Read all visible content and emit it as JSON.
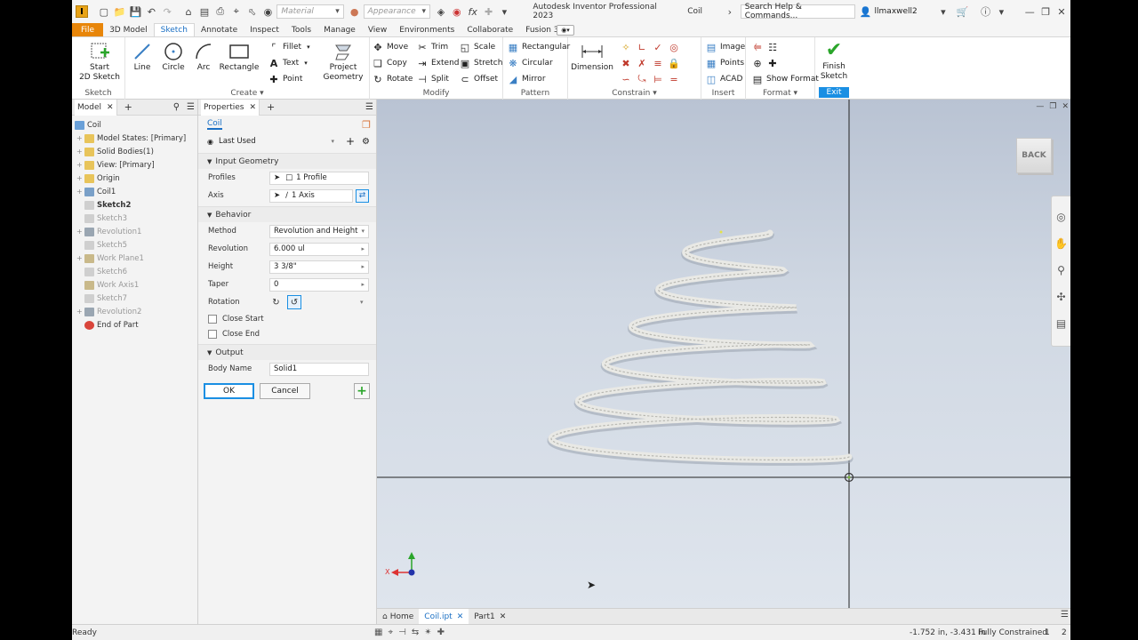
{
  "app": {
    "title": "Autodesk Inventor Professional 2023",
    "doc": "Coil",
    "search_placeholder": "Search Help & Commands...",
    "user": "llmaxwell2",
    "material_placeholder": "Material",
    "appearance_placeholder": "Appearance",
    "logo": "I"
  },
  "menu": {
    "tabs": [
      "File",
      "3D Model",
      "Sketch",
      "Annotate",
      "Inspect",
      "Tools",
      "Manage",
      "View",
      "Environments",
      "Collaborate",
      "Fusion 360"
    ],
    "active": "Sketch"
  },
  "ribbon": {
    "sketch": {
      "start": "Start",
      "start2": "2D Sketch",
      "label": "Sketch"
    },
    "create": {
      "line": "Line",
      "circle": "Circle",
      "arc": "Arc",
      "rectangle": "Rectangle",
      "fillet": "Fillet",
      "text": "Text",
      "point": "Point",
      "project": "Project",
      "project2": "Geometry",
      "label": "Create"
    },
    "modify": {
      "move": "Move",
      "trim": "Trim",
      "scale": "Scale",
      "copy": "Copy",
      "extend": "Extend",
      "stretch": "Stretch",
      "rotate": "Rotate",
      "split": "Split",
      "offset": "Offset",
      "label": "Modify"
    },
    "pattern": {
      "rectangular": "Rectangular",
      "circular": "Circular",
      "mirror": "Mirror",
      "label": "Pattern"
    },
    "constrain": {
      "dimension": "Dimension",
      "label": "Constrain"
    },
    "insert": {
      "image": "Image",
      "points": "Points",
      "acad": "ACAD",
      "label": "Insert"
    },
    "format": {
      "show_format": "Show Format",
      "label": "Format"
    },
    "exit": {
      "finish": "Finish",
      "finish2": "Sketch",
      "label": "Exit"
    }
  },
  "model": {
    "tab": "Model",
    "root": "Coil",
    "items": [
      {
        "label": "Model States: [Primary]",
        "dim": false,
        "bold": false,
        "expand": true,
        "color": "#e8c45a"
      },
      {
        "label": "Solid Bodies(1)",
        "dim": false,
        "bold": false,
        "expand": true,
        "color": "#e8c45a"
      },
      {
        "label": "View: [Primary]",
        "dim": false,
        "bold": false,
        "expand": true,
        "color": "#e8c45a"
      },
      {
        "label": "Origin",
        "dim": false,
        "bold": false,
        "expand": true,
        "color": "#e8c45a"
      },
      {
        "label": "Coil1",
        "dim": false,
        "bold": false,
        "expand": true,
        "color": "#7aa0c8"
      },
      {
        "label": "Sketch2",
        "dim": false,
        "bold": true,
        "expand": false,
        "color": "#cfcfcf"
      },
      {
        "label": "Sketch3",
        "dim": true,
        "bold": false,
        "expand": false,
        "color": "#cfcfcf"
      },
      {
        "label": "Revolution1",
        "dim": true,
        "bold": false,
        "expand": true,
        "color": "#9aa6b2"
      },
      {
        "label": "Sketch5",
        "dim": true,
        "bold": false,
        "expand": false,
        "color": "#cfcfcf"
      },
      {
        "label": "Work Plane1",
        "dim": true,
        "bold": false,
        "expand": true,
        "color": "#c9b98a"
      },
      {
        "label": "Sketch6",
        "dim": true,
        "bold": false,
        "expand": false,
        "color": "#cfcfcf"
      },
      {
        "label": "Work Axis1",
        "dim": true,
        "bold": false,
        "expand": false,
        "color": "#c9b98a"
      },
      {
        "label": "Sketch7",
        "dim": true,
        "bold": false,
        "expand": false,
        "color": "#cfcfcf"
      },
      {
        "label": "Revolution2",
        "dim": true,
        "bold": false,
        "expand": true,
        "color": "#9aa6b2"
      },
      {
        "label": "End of Part",
        "dim": false,
        "bold": false,
        "expand": false,
        "color": "#d9453b"
      }
    ]
  },
  "properties": {
    "tab": "Properties",
    "feature": "Coil",
    "preset": "Last Used",
    "input_geometry": "Input Geometry",
    "profiles_label": "Profiles",
    "profiles_value": "1 Profile",
    "axis_label": "Axis",
    "axis_value": "1 Axis",
    "behavior": "Behavior",
    "method_label": "Method",
    "method_value": "Revolution and Height",
    "revolution_label": "Revolution",
    "revolution_value": "6.000 ul",
    "height_label": "Height",
    "height_value": "3 3/8\"",
    "taper_label": "Taper",
    "taper_value": "0",
    "rotation_label": "Rotation",
    "close_start": "Close Start",
    "close_end": "Close End",
    "output": "Output",
    "body_name_label": "Body Name",
    "body_name_value": "Solid1",
    "ok": "OK",
    "cancel": "Cancel"
  },
  "viewcube": {
    "label": "BACK"
  },
  "triad": {
    "x": "X"
  },
  "doctabs": [
    {
      "label": "Home",
      "active": false,
      "close": false
    },
    {
      "label": "Coil.ipt",
      "active": true,
      "close": true
    },
    {
      "label": "Part1",
      "active": false,
      "close": true
    }
  ],
  "status": {
    "left": "Ready",
    "coords": "-1.752 in, -3.431 in",
    "constraint": "Fully Constrained",
    "n1": "1",
    "n2": "2"
  }
}
